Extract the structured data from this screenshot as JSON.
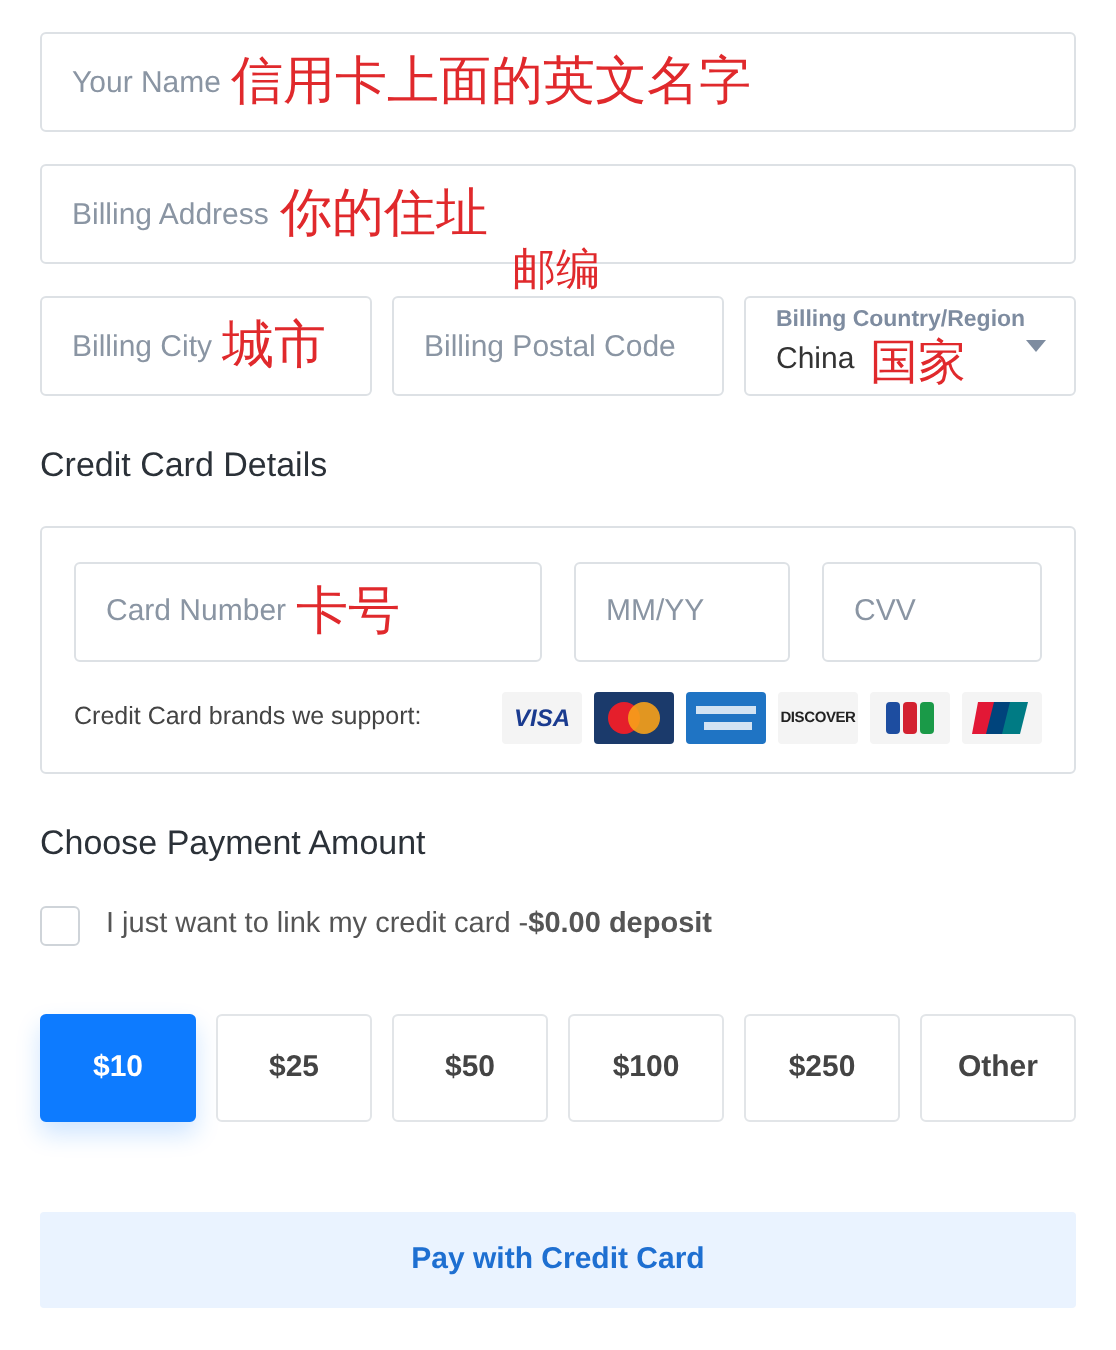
{
  "billing_fields": [
    {
      "kind": "input",
      "placeholder": "Your Name",
      "annotation": "信用卡上面的英文名字"
    },
    {
      "kind": "input",
      "placeholder": "Billing Address",
      "annotation": "你的住址"
    }
  ],
  "location_fields": [
    {
      "kind": "input",
      "placeholder": "Billing City",
      "annotation": "城市"
    },
    {
      "kind": "input",
      "placeholder": "Billing Postal Code",
      "annotation": "邮编"
    },
    {
      "kind": "select",
      "label": "Billing Country/Region",
      "value": "China",
      "annotation": "国家"
    }
  ],
  "card_section": {
    "title": "Credit Card Details",
    "fields": [
      {
        "placeholder": "Card Number",
        "annotation": "卡号"
      },
      {
        "placeholder": "MM/YY"
      },
      {
        "placeholder": "CVV"
      }
    ],
    "brands_label": "Credit Card brands we support:",
    "brands": [
      {
        "kind": "visa",
        "text": "VISA"
      },
      {
        "kind": "mastercard"
      },
      {
        "kind": "amex"
      },
      {
        "kind": "discover",
        "text": "DISCOVER"
      },
      {
        "kind": "jcb"
      },
      {
        "kind": "unionpay"
      }
    ]
  },
  "payment": {
    "title": "Choose Payment Amount",
    "link_only": {
      "label": "I just want to link my credit card -**$0.00 deposit**",
      "checked": false
    },
    "amounts": [
      {
        "label": "$10",
        "selected": true
      },
      {
        "label": "$25",
        "selected": false
      },
      {
        "label": "$50",
        "selected": false
      },
      {
        "label": "$100",
        "selected": false
      },
      {
        "label": "$250",
        "selected": false
      },
      {
        "label": "Other",
        "selected": false
      }
    ]
  },
  "pay_button": "Pay with Credit Card"
}
